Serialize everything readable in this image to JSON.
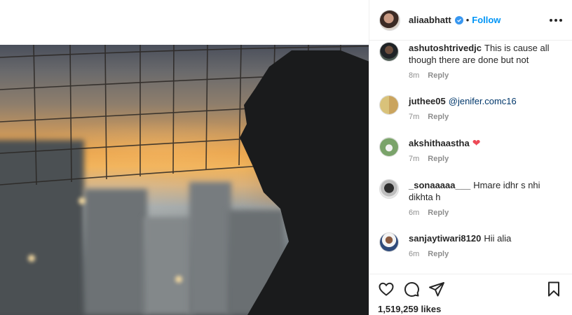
{
  "post": {
    "username": "aliaabhatt",
    "follow_label": "Follow",
    "separator": "•",
    "likes": "1,519,259 likes"
  },
  "comments": [
    {
      "user": "ashutoshtrivedjc",
      "text": "This is cause all though there are done but not",
      "time": "8m",
      "reply": "Reply"
    },
    {
      "user": "juthee05",
      "mention": "@jenifer.comc16",
      "time": "7m",
      "reply": "Reply"
    },
    {
      "user": "akshithaastha",
      "emoji": "❤",
      "time": "7m",
      "reply": "Reply"
    },
    {
      "user": "_sonaaaaa___",
      "text": "Hmare idhr s nhi dikhta h",
      "time": "6m",
      "reply": "Reply"
    },
    {
      "user": "sanjaytiwari8120",
      "text": "Hii alia",
      "time": "6m",
      "reply": "Reply"
    }
  ],
  "icons": {
    "like": "heart-icon",
    "comment": "comment-bubble-icon",
    "share": "paper-plane-icon",
    "save": "bookmark-icon",
    "more": "more-options-icon",
    "verified": "verified-badge-icon"
  },
  "colors": {
    "accent": "#0095f6",
    "verified": "#3897f0",
    "heart": "#ed4956",
    "text": "#262626",
    "muted": "#8e8e8e"
  }
}
